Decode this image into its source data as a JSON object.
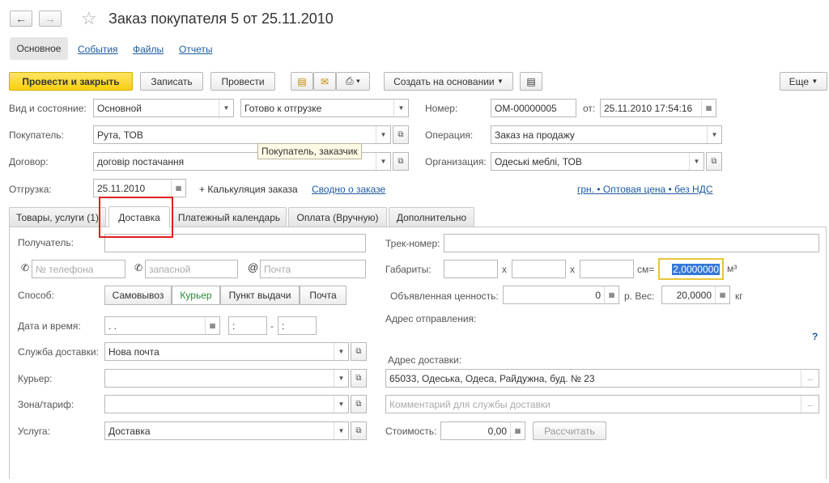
{
  "header": {
    "title": "Заказ покупателя 5 от 25.11.2010"
  },
  "menu": {
    "main": "Основное",
    "events": "События",
    "files": "Файлы",
    "reports": "Отчеты"
  },
  "toolbar": {
    "post_close": "Провести и закрыть",
    "save": "Записать",
    "post": "Провести",
    "create_based": "Создать на основании",
    "more": "Еще"
  },
  "form": {
    "kind_label": "Вид и состояние:",
    "kind_value": "Основной",
    "state_value": "Готово к отгрузке",
    "number_label": "Номер:",
    "number_value": "ОМ-00000005",
    "date_label": "от:",
    "date_value": "25.11.2010 17:54:16",
    "buyer_label": "Покупатель:",
    "buyer_value": "Рута, ТОВ",
    "operation_label": "Операция:",
    "operation_value": "Заказ на продажу",
    "contract_label": "Договор:",
    "contract_value": "договір постачання",
    "org_label": "Организация:",
    "org_value": "Одеські меблі, ТОВ",
    "ship_label": "Отгрузка:",
    "ship_value": "25.11.2010",
    "calc_text": "+ Калькуляция заказа",
    "summary_link": "Сводно о заказе",
    "price_link": "грн. • Оптовая цена • без НДС",
    "tooltip": "Покупатель, заказчик"
  },
  "tabs": [
    "Товары, услуги (1)",
    "Доставка",
    "Платежный календарь",
    "Оплата (Вручную)",
    "Дополнительно"
  ],
  "delivery": {
    "recipient_label": "Получатель:",
    "phone_ph": "№ телефона",
    "alt_ph": "запасной",
    "email_ph": "Почта",
    "method_label": "Способ:",
    "methods": [
      "Самовывоз",
      "Курьер",
      "Пункт выдачи",
      "Почта"
    ],
    "datetime_label": "Дата и время:",
    "date_ph": " .  .",
    "time_ph": " :",
    "service_label": "Служба доставки:",
    "service_value": "Нова почта",
    "courier_label": "Курьер:",
    "zone_label": "Зона/тариф:",
    "usluga_label": "Услуга:",
    "usluga_value": "Доставка",
    "track_label": "Трек-номер:",
    "dims_label": "Габариты:",
    "x": "x",
    "cm": "см=",
    "volume": "2,0000000",
    "m3": "м³",
    "declared_label": "Объявленная ценность:",
    "declared_value": "0",
    "weight_label": "р. Вес:",
    "weight_value": "20,0000",
    "kg": "кг",
    "from_label": "Адрес отправления:",
    "help": "?",
    "to_label": "Адрес доставки:",
    "to_value": "65033, Одеська, Одеса, Райдужна, буд. № 23",
    "comment_ph": "Комментарий для службы доставки",
    "cost_label": "Стоимость:",
    "cost_value": "0,00",
    "calc_btn": "Рассчитать"
  }
}
